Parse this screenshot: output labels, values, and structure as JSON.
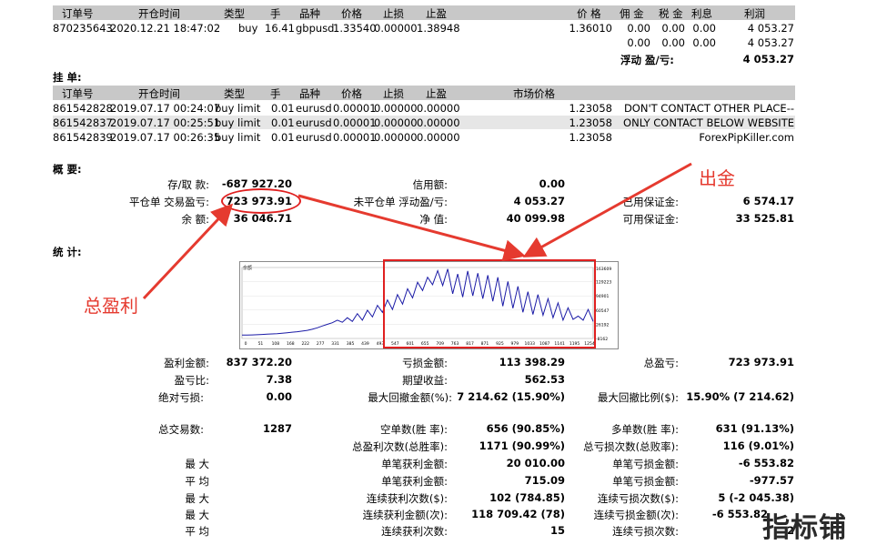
{
  "positions": {
    "header": {
      "ticket": "订单号",
      "open_time": "开仓时间",
      "type": "类型",
      "lots": "手",
      "symbol": "品种",
      "price": "价格",
      "sl": "止损",
      "tp": "止盈",
      "close_price": "价 格",
      "commission": "佣 金",
      "tax": "税 金",
      "swap": "利息",
      "profit": "利润"
    },
    "rows": [
      {
        "ticket": "870235643",
        "open_time": "2020.12.21 18:47:02",
        "type": "buy",
        "lots": "16.41",
        "symbol": "gbpusd",
        "price": "1.33540",
        "sl": "0.00000",
        "tp": "1.38948",
        "close_price": "1.36010",
        "commission": "0.00",
        "tax": "0.00",
        "swap": "0.00",
        "profit": "4 053.27"
      }
    ],
    "totals": {
      "commission": "0.00",
      "tax": "0.00",
      "swap": "0.00",
      "profit": "4 053.27"
    },
    "floating_label": "浮动 盈/亏:",
    "floating_value": "4 053.27"
  },
  "pending": {
    "title": "挂 单:",
    "header": {
      "ticket": "订单号",
      "open_time": "开仓时间",
      "type": "类型",
      "lots": "手",
      "symbol": "品种",
      "price": "价格",
      "sl": "止损",
      "tp": "止盈",
      "market_price": "市场价格"
    },
    "rows": [
      {
        "ticket": "861542828",
        "open_time": "2019.07.17 00:24:07",
        "type": "buy limit",
        "lots": "0.01",
        "symbol": "eurusd",
        "price": "0.00001",
        "sl": "0.00000",
        "tp": "0.00000",
        "market_price": "1.23058",
        "comment": "DON'T CONTACT OTHER PLACE--"
      },
      {
        "ticket": "861542837",
        "open_time": "2019.07.17 00:25:51",
        "type": "buy limit",
        "lots": "0.01",
        "symbol": "eurusd",
        "price": "0.00001",
        "sl": "0.00000",
        "tp": "0.00000",
        "market_price": "1.23058",
        "comment": "ONLY CONTACT BELOW WEBSITE"
      },
      {
        "ticket": "861542839",
        "open_time": "2019.07.17 00:26:35",
        "type": "buy limit",
        "lots": "0.01",
        "symbol": "eurusd",
        "price": "0.00001",
        "sl": "0.00000",
        "tp": "0.00000",
        "market_price": "1.23058",
        "comment": "ForexPipKiller.com"
      }
    ]
  },
  "summary": {
    "title": "概 要:",
    "deposit_label": "存/取 款:",
    "deposit_value": "-687 927.20",
    "credit_label": "信用额:",
    "credit_value": "0.00",
    "closed_pl_label": "平仓单 交易盈亏:",
    "closed_pl_value": "723 973.91",
    "floating_label": "未平仓单 浮动盈/亏:",
    "floating_value": "4 053.27",
    "margin_label": "已用保证金:",
    "margin_value": "6 574.17",
    "balance_label": "余 额:",
    "balance_value": "36 046.71",
    "equity_label": "净 值:",
    "equity_value": "40 099.98",
    "free_margin_label": "可用保证金:",
    "free_margin_value": "33 525.81"
  },
  "annotations": {
    "withdraw": "出金",
    "total_profit": "总盈利"
  },
  "stats": {
    "title": "统 计:",
    "gross_profit_label": "盈利金额:",
    "gross_profit_value": "837 372.20",
    "gross_loss_label": "亏损金额:",
    "gross_loss_value": "113 398.29",
    "total_net_label": "总盈亏:",
    "total_net_value": "723 973.91",
    "profit_factor_label": "盈亏比:",
    "profit_factor_value": "7.38",
    "expected_label": "期望收益:",
    "expected_value": "562.53",
    "abs_dd_label": "绝对亏损:",
    "abs_dd_value": "0.00",
    "max_dd_label": "最大回撤金额(%):",
    "max_dd_value": "7 214.62 (15.90%)",
    "rel_dd_label": "最大回撤比例($):",
    "rel_dd_value": "15.90% (7 214.62)",
    "total_trades_label": "总交易数:",
    "total_trades_value": "1287",
    "short_label": "空单数(胜 率):",
    "short_value": "656 (90.85%)",
    "long_label": "多单数(胜 率):",
    "long_value": "631 (91.13%)",
    "win_count_label": "总盈利次数(总胜率):",
    "win_count_value": "1171 (90.99%)",
    "loss_count_label": "总亏损次数(总败率):",
    "loss_count_value": "116 (9.01%)",
    "largest": "最 大",
    "largest_profit_label": "单笔获利金额:",
    "largest_profit_value": "20 010.00",
    "largest_loss_label": "单笔亏损金额:",
    "largest_loss_value": "-6 553.82",
    "average": "平 均",
    "avg_profit_label": "单笔获利金额:",
    "avg_profit_value": "715.09",
    "avg_loss_label": "单笔亏损金额:",
    "avg_loss_value": "-977.57",
    "max_consec_label_a": "最 大",
    "consec_wins_label": "连续获利次数($):",
    "consec_wins_value": "102 (784.85)",
    "consec_losses_label": "连续亏损次数($):",
    "consec_losses_value": "5 (-2 045.38)",
    "max_consec_label_b": "最 大",
    "consec_profit_label": "连续获利金额(次):",
    "consec_profit_value": "118 709.42 (78)",
    "consec_loss_label": "连续亏损金额(次):",
    "consec_loss_value": "-6 553.82",
    "avg_consec_label": "平 均",
    "avg_consec_wins_label": "连续获利次数:",
    "avg_consec_wins_value": "15",
    "avg_consec_losses_label": "连续亏损次数:",
    "avg_consec_losses_value": "2"
  },
  "chart_data": {
    "type": "line",
    "title": "余额",
    "x_ticks": [
      "0",
      "51",
      "108",
      "168",
      "222",
      "277",
      "331",
      "385",
      "439",
      "493",
      "547",
      "601",
      "655",
      "709",
      "763",
      "817",
      "871",
      "925",
      "979",
      "1033",
      "1087",
      "1141",
      "1195",
      "1254"
    ],
    "y_ticks": [
      "163609",
      "129223",
      "94901",
      "60547",
      "26192",
      "-8162"
    ],
    "series": [
      {
        "values": [
          0,
          200,
          500,
          900,
          1500,
          2100,
          2800,
          3600,
          4600,
          5800,
          7000,
          8200,
          9700,
          11500,
          14000,
          17500,
          22000,
          26000,
          30000,
          36000,
          31000,
          42000,
          33000,
          52000,
          36000,
          60000,
          44000,
          72000,
          55000,
          85000,
          62000,
          98000,
          75000,
          112000,
          90000,
          128000,
          108000,
          140000,
          122000,
          156000,
          120000,
          160000,
          100000,
          148000,
          92000,
          155000,
          95000,
          150000,
          88000,
          145000,
          82000,
          140000,
          70000,
          130000,
          65000,
          118000,
          55000,
          105000,
          50000,
          98000,
          48000,
          88000,
          42000,
          78000,
          36000,
          66000,
          38000,
          46000,
          36000,
          62000,
          33000
        ]
      }
    ],
    "ylim": [
      -8162,
      163609
    ]
  },
  "watermark": "指标铺"
}
